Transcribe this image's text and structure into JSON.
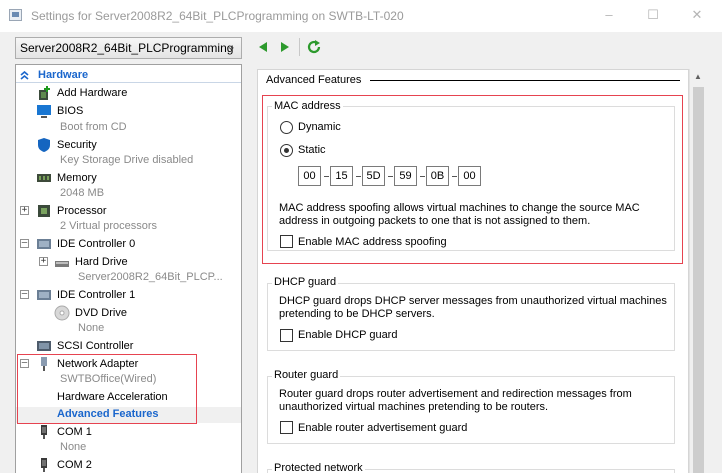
{
  "window": {
    "title": "Settings for Server2008R2_64Bit_PLCProgramming on SWTB-LT-020",
    "minimize": "–",
    "maximize": "☐",
    "close": "✕"
  },
  "toolbar": {
    "vm_selected": "Server2008R2_64Bit_PLCProgramming"
  },
  "sidebar": {
    "section": "Hardware",
    "items": [
      {
        "label": "Add Hardware"
      },
      {
        "label": "BIOS",
        "sub": "Boot from CD"
      },
      {
        "label": "Security",
        "sub": "Key Storage Drive disabled"
      },
      {
        "label": "Memory",
        "sub": "2048 MB"
      },
      {
        "label": "Processor",
        "sub": "2 Virtual processors"
      },
      {
        "label": "IDE Controller 0"
      },
      {
        "label": "Hard Drive",
        "sub": "Server2008R2_64Bit_PLCP..."
      },
      {
        "label": "IDE Controller 1"
      },
      {
        "label": "DVD Drive",
        "sub": "None"
      },
      {
        "label": "SCSI Controller"
      },
      {
        "label": "Network Adapter",
        "sub": "SWTBOffice(Wired)"
      },
      {
        "label": "Hardware Acceleration"
      },
      {
        "label": "Advanced Features"
      },
      {
        "label": "COM 1",
        "sub": "None"
      },
      {
        "label": "COM 2"
      }
    ]
  },
  "main": {
    "header": "Advanced Features",
    "mac": {
      "title": "MAC address",
      "dynamic_label": "Dynamic",
      "static_label": "Static",
      "selected": "Static",
      "octets": [
        "00",
        "15",
        "5D",
        "59",
        "0B",
        "00"
      ],
      "desc_line1": "MAC address spoofing allows virtual machines to change the source MAC",
      "desc_line2": "address in outgoing packets to one that is not assigned to them.",
      "spoof_label": "Enable MAC address spoofing"
    },
    "dhcp": {
      "title": "DHCP guard",
      "desc_line1": "DHCP guard drops DHCP server messages from unauthorized virtual machines",
      "desc_line2": "pretending to be DHCP servers.",
      "checkbox_label": "Enable DHCP guard"
    },
    "router": {
      "title": "Router guard",
      "desc_line1": "Router guard drops router advertisement and redirection messages from",
      "desc_line2": "unauthorized virtual machines pretending to be routers.",
      "checkbox_label": "Enable router advertisement guard"
    },
    "protected": {
      "title": "Protected network"
    }
  },
  "colors": {
    "highlight_border": "#e64350",
    "selected_text": "#1a66cc",
    "accent_blue": "#1a66cc"
  }
}
